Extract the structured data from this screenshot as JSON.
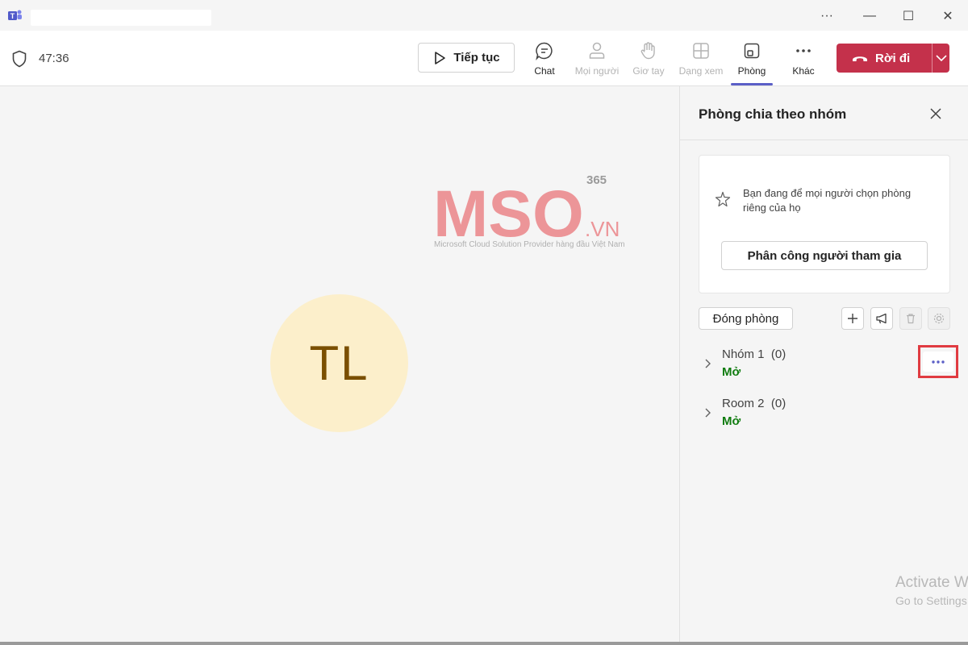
{
  "window": {
    "minimize_glyph": "—",
    "maximize_glyph": "☐",
    "close_glyph": "✕",
    "more_glyph": "···"
  },
  "toolbar": {
    "timer": "47:36",
    "resume_label": "Tiếp tục",
    "tools": [
      {
        "label": "Chat",
        "icon": "chat-icon",
        "enabled": true
      },
      {
        "label": "Mọi người",
        "icon": "people-icon",
        "enabled": false
      },
      {
        "label": "Giơ tay",
        "icon": "raise-hand-icon",
        "enabled": false
      },
      {
        "label": "Dạng xem",
        "icon": "view-icon",
        "enabled": false
      },
      {
        "label": "Phòng",
        "icon": "rooms-icon",
        "enabled": true,
        "active": true
      },
      {
        "label": "Khác",
        "icon": "more-icon",
        "enabled": true
      }
    ],
    "leave_label": "Rời đi"
  },
  "stage": {
    "avatar_initials": "TL",
    "watermark_text": "MSO",
    "watermark_suffix": ".VN",
    "watermark_sup": "365",
    "watermark_tagline": "Microsoft Cloud Solution Provider hàng đầu Việt Nam"
  },
  "panel": {
    "title": "Phòng chia theo nhóm",
    "info_text": "Bạn đang để mọi người chọn phòng riêng của họ",
    "assign_label": "Phân công người tham gia",
    "close_rooms_label": "Đóng phòng",
    "rooms": [
      {
        "name": "Nhóm 1",
        "count": "(0)",
        "status": "Mở"
      },
      {
        "name": "Room 2",
        "count": "(0)",
        "status": "Mở"
      }
    ]
  },
  "os_overlay": {
    "line1": "Activate W",
    "line2": "Go to Settings"
  },
  "colors": {
    "accent": "#5b5fc7",
    "leave": "#c4314b",
    "open_status": "#107c10",
    "avatar_bg": "#fcefcb",
    "highlight": "#e03b41",
    "watermark": "#ec8b8f"
  }
}
